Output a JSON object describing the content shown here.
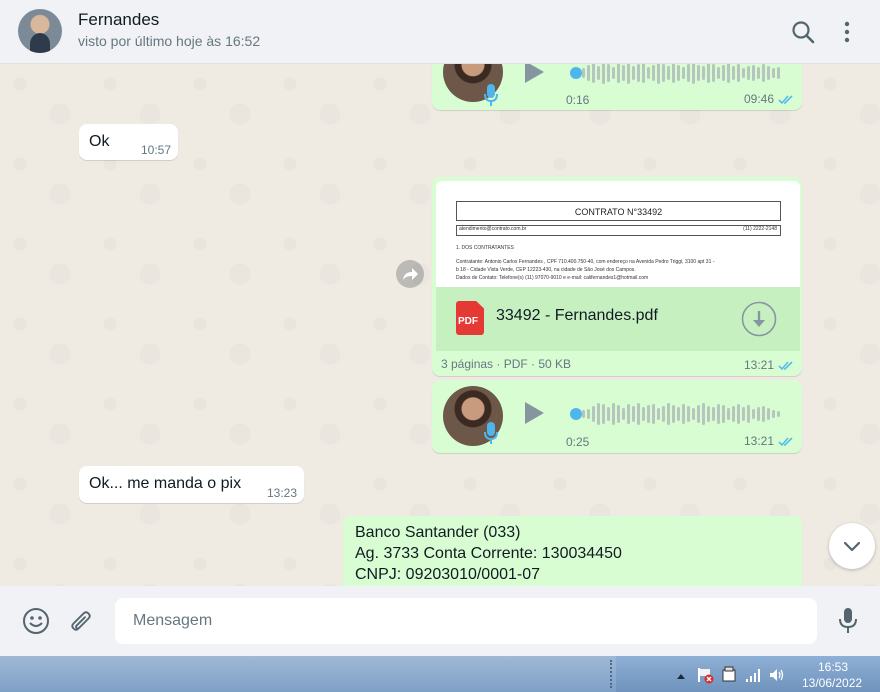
{
  "header": {
    "contact_name": "Fernandes",
    "status": "visto por último hoje às 16:52"
  },
  "messages": {
    "audio1": {
      "duration": "0:16",
      "time": "09:46"
    },
    "in1": {
      "text": "Ok",
      "time": "10:57"
    },
    "doc": {
      "preview_title": "CONTRATO N°33492",
      "preview_email": "atendimento@contrato.com.br",
      "preview_phone": "(11) 2222-2148",
      "preview_section": "1. DOS CONTRATANTES",
      "preview_line1": "Contratante: Antonio Carlos Fernandes , CPF 710.400.750-40, com endereço na Avenida Pedro Triggi, 3100 apt 31 -",
      "preview_line2": "b 18 - Cidade Vista Verde, CEP 12223-430, na cidade de São José dos Campos.",
      "preview_line3": "Dados de Contato: Telefone(s) (11) 97070-9010 e e-mail: califernandes1@hotmail.com",
      "pdf_badge": "PDF",
      "filename": "33492 - Fernandes.pdf",
      "meta": "3 páginas · PDF · 50 KB",
      "time": "13:21"
    },
    "audio2": {
      "duration": "0:25",
      "time": "13:21"
    },
    "in2": {
      "text": "Ok... me manda o pix",
      "time": "13:23"
    },
    "bank": {
      "line1": "Banco Santander (033)",
      "line2": "Ag. 3733 Conta Corrente: 130034450",
      "line3": "CNPJ: 09203010/0001-07"
    }
  },
  "composer": {
    "placeholder": "Mensagem"
  },
  "taskbar": {
    "clock_time": "16:53",
    "clock_date": "13/06/2022"
  },
  "colors": {
    "outgoing": "#d9fdd3",
    "incoming": "#ffffff",
    "read_ticks": "#53bdeb",
    "pdf_red": "#e53935"
  }
}
